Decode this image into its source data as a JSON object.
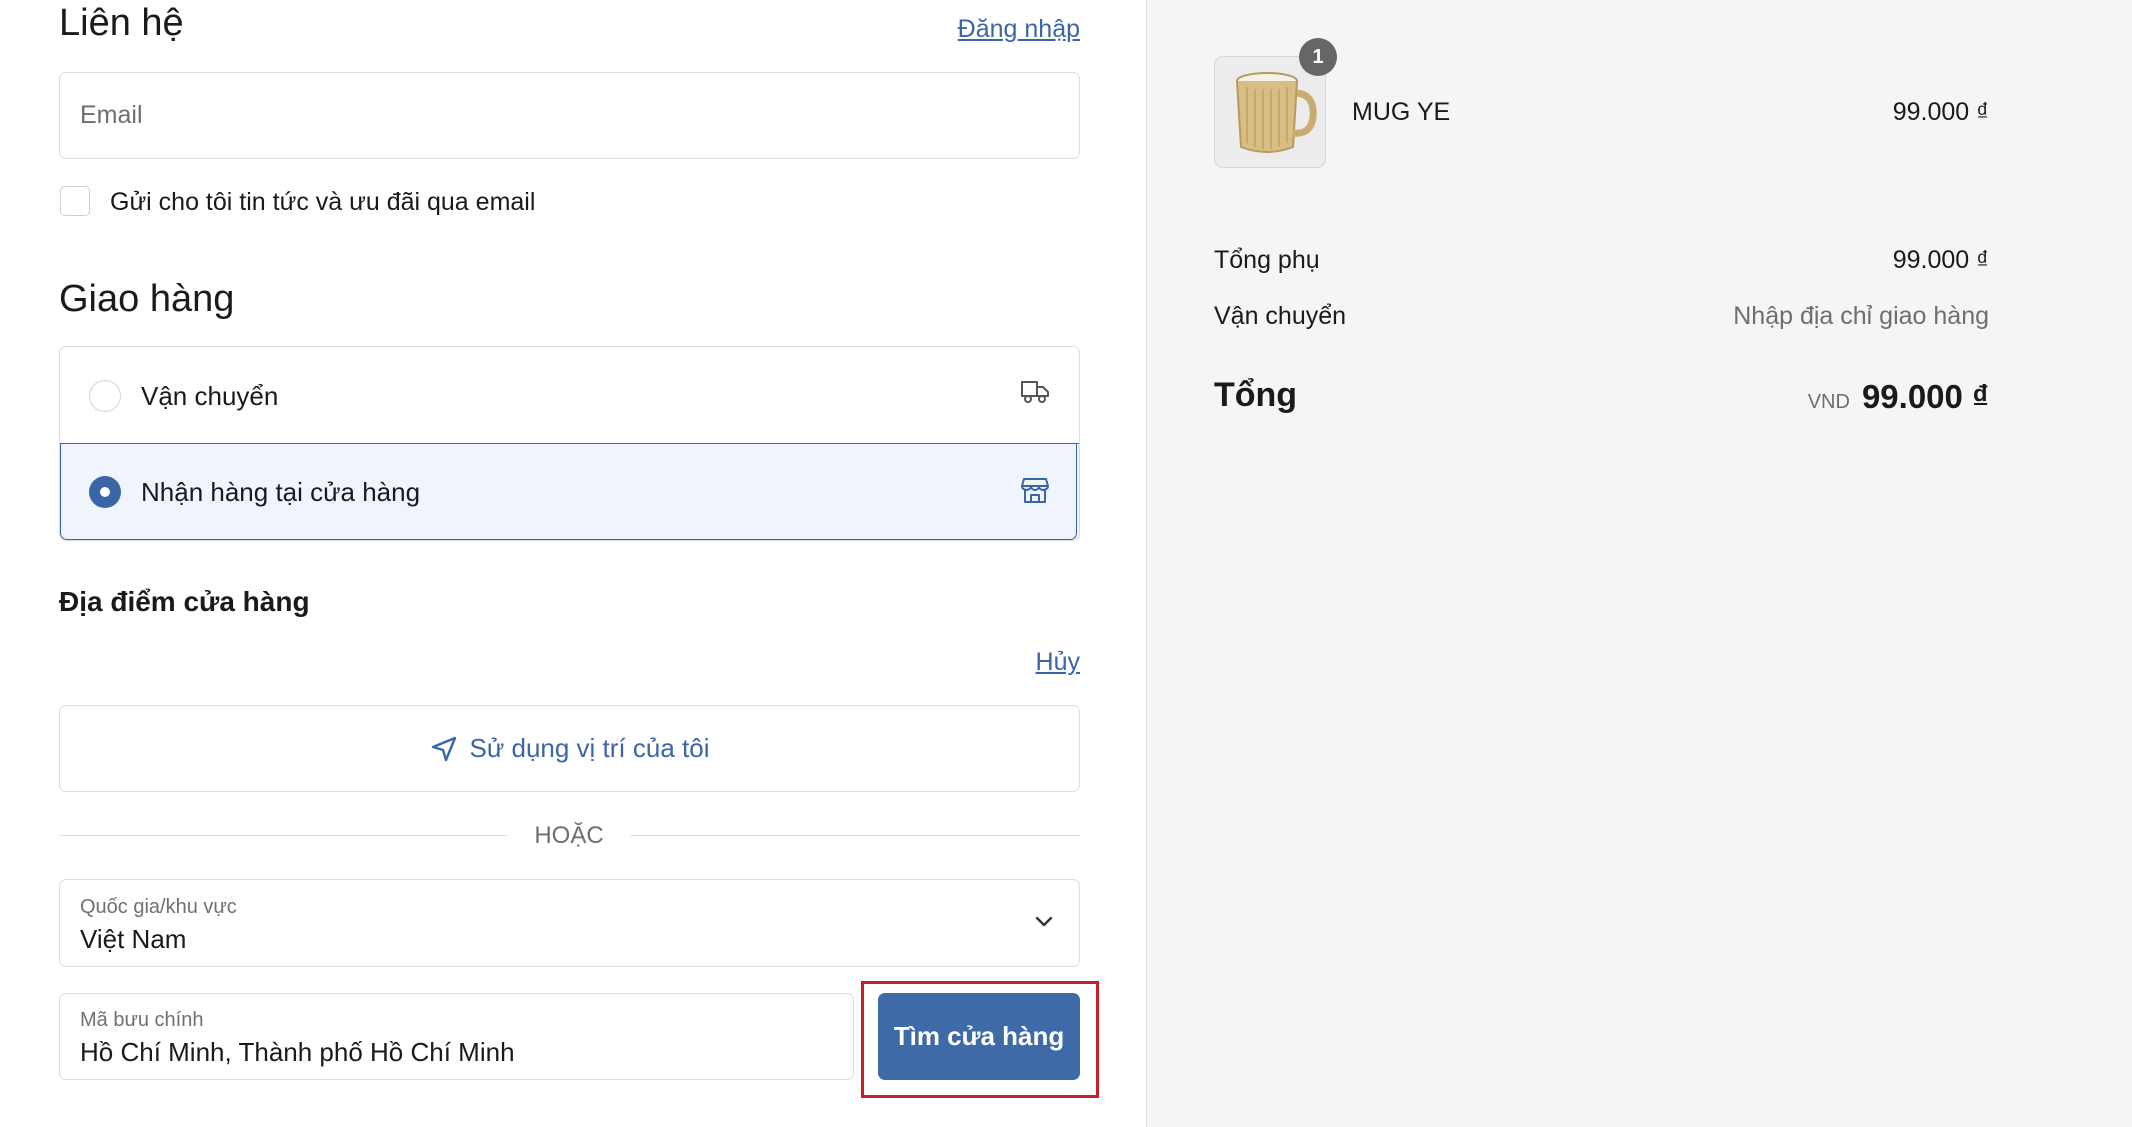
{
  "contact": {
    "title": "Liên hệ",
    "login_link": "Đăng nhập",
    "email_placeholder": "Email",
    "newsletter_label": "Gửi cho tôi tin tức và ưu đãi qua email"
  },
  "delivery": {
    "title": "Giao hàng",
    "options": [
      {
        "label": "Vận chuyển",
        "selected": false,
        "icon": "truck-icon"
      },
      {
        "label": "Nhận hàng tại cửa hàng",
        "selected": true,
        "icon": "store-icon"
      }
    ]
  },
  "store_location": {
    "title": "Địa điểm cửa hàng",
    "cancel_link": "Hủy",
    "use_location_label": "Sử dụng vị trí của tôi",
    "or_label": "HOẶC",
    "country_label": "Quốc gia/khu vực",
    "country_value": "Việt Nam",
    "postal_label": "Mã bưu chính",
    "postal_value": "Hồ Chí Minh, Thành phố Hồ Chí Minh",
    "find_store_button": "Tìm cửa hàng"
  },
  "summary": {
    "item": {
      "name": "MUG YE",
      "quantity": "1",
      "price": "99.000 ₫"
    },
    "subtotal_label": "Tổng phụ",
    "subtotal_value": "99.000 ₫",
    "shipping_label": "Vận chuyển",
    "shipping_value": "Nhập địa chỉ giao hàng",
    "total_label": "Tổng",
    "currency": "VND",
    "total_value": "99.000 ₫"
  },
  "colors": {
    "accent": "#3a65a8",
    "selected_bg": "#f0f5fd",
    "highlight_border": "#c8202a"
  }
}
